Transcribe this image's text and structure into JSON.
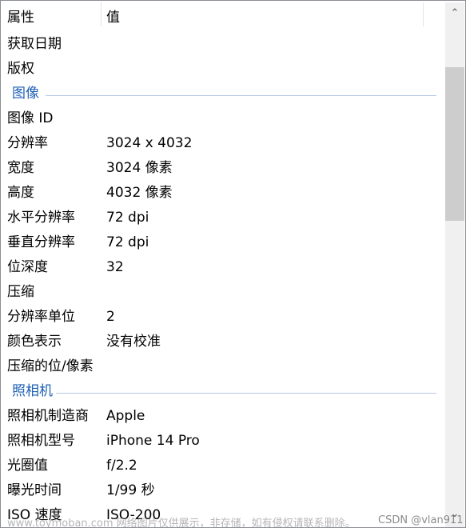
{
  "header": {
    "col_property": "属性",
    "col_value": "值"
  },
  "rows": [
    {
      "type": "row",
      "key": "获取日期",
      "value": ""
    },
    {
      "type": "row",
      "key": "版权",
      "value": ""
    },
    {
      "type": "section",
      "key": "图像"
    },
    {
      "type": "row",
      "key": "图像 ID",
      "value": ""
    },
    {
      "type": "row",
      "key": "分辨率",
      "value": "3024 x 4032"
    },
    {
      "type": "row",
      "key": "宽度",
      "value": "3024 像素"
    },
    {
      "type": "row",
      "key": "高度",
      "value": "4032 像素"
    },
    {
      "type": "row",
      "key": "水平分辨率",
      "value": "72 dpi"
    },
    {
      "type": "row",
      "key": "垂直分辨率",
      "value": "72 dpi"
    },
    {
      "type": "row",
      "key": "位深度",
      "value": "32"
    },
    {
      "type": "row",
      "key": "压缩",
      "value": ""
    },
    {
      "type": "row",
      "key": "分辨率单位",
      "value": "2"
    },
    {
      "type": "row",
      "key": "颜色表示",
      "value": "没有校准"
    },
    {
      "type": "row",
      "key": "压缩的位/像素",
      "value": ""
    },
    {
      "type": "section",
      "key": "照相机"
    },
    {
      "type": "row",
      "key": "照相机制造商",
      "value": "Apple"
    },
    {
      "type": "row",
      "key": "照相机型号",
      "value": "iPhone 14 Pro"
    },
    {
      "type": "row",
      "key": "光圈值",
      "value": "f/2.2"
    },
    {
      "type": "row",
      "key": "曝光时间",
      "value": "1/99 秒"
    },
    {
      "type": "row",
      "key": "ISO 速度",
      "value": "ISO-200"
    }
  ],
  "scrollbar": {
    "up_icon": "chevron-up-icon",
    "down_icon": "chevron-down-icon"
  },
  "watermark": {
    "left": "www.toymoban.com 网络图片仅供展示，非存储，如有侵权请联系删除。",
    "right": "CSDN @vlan911"
  },
  "colors": {
    "section": "#1e5fb4",
    "section_line": "#b7c8e8",
    "thumb": "#cdcdcd"
  }
}
